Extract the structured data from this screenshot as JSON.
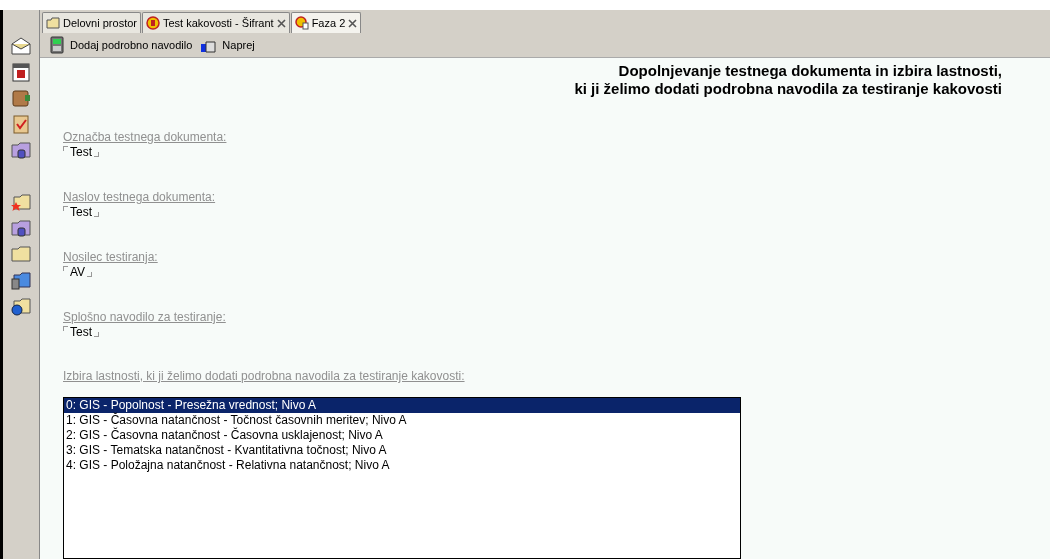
{
  "tabs": [
    {
      "label": "Delovni prostor",
      "closable": false,
      "selected": false
    },
    {
      "label": "Test kakovosti - Šifrant",
      "closable": true,
      "selected": false
    },
    {
      "label": "Faza 2",
      "closable": true,
      "selected": true
    }
  ],
  "toolbar": [
    {
      "label": "Dodaj podrobno navodilo"
    },
    {
      "label": "Naprej"
    }
  ],
  "title": [
    "Dopolnjevanje testnega dokumenta in izbira lastnosti,",
    "ki ji želimo dodati podrobna navodila za testiranje kakovosti"
  ],
  "fields": [
    {
      "label": "Označba testnega dokumenta:",
      "value": "Test"
    },
    {
      "label": "Naslov testnega dokumenta:",
      "value": "Test"
    },
    {
      "label": "Nosilec testiranja:",
      "value": "AV"
    },
    {
      "label": "Splošno navodilo za testiranje:",
      "value": "Test"
    }
  ],
  "list": {
    "label": "Izbira lastnosti, ki ji želimo dodati podrobna navodila za testiranje kakovosti:",
    "items": [
      {
        "text": "0: GIS - Popolnost - Presežna vrednost; Nivo A",
        "selected": true
      },
      {
        "text": "1: GIS - Časovna natančnost - Točnost časovnih meritev; Nivo A",
        "selected": false
      },
      {
        "text": "2: GIS - Časovna natančnost - Časovna usklajenost; Nivo A",
        "selected": false
      },
      {
        "text": "3: GIS - Tematska natančnost - Kvantitativna točnost; Nivo A",
        "selected": false
      },
      {
        "text": "4: GIS - Položajna natančnost - Relativna natančnost; Nivo A",
        "selected": false
      }
    ]
  }
}
